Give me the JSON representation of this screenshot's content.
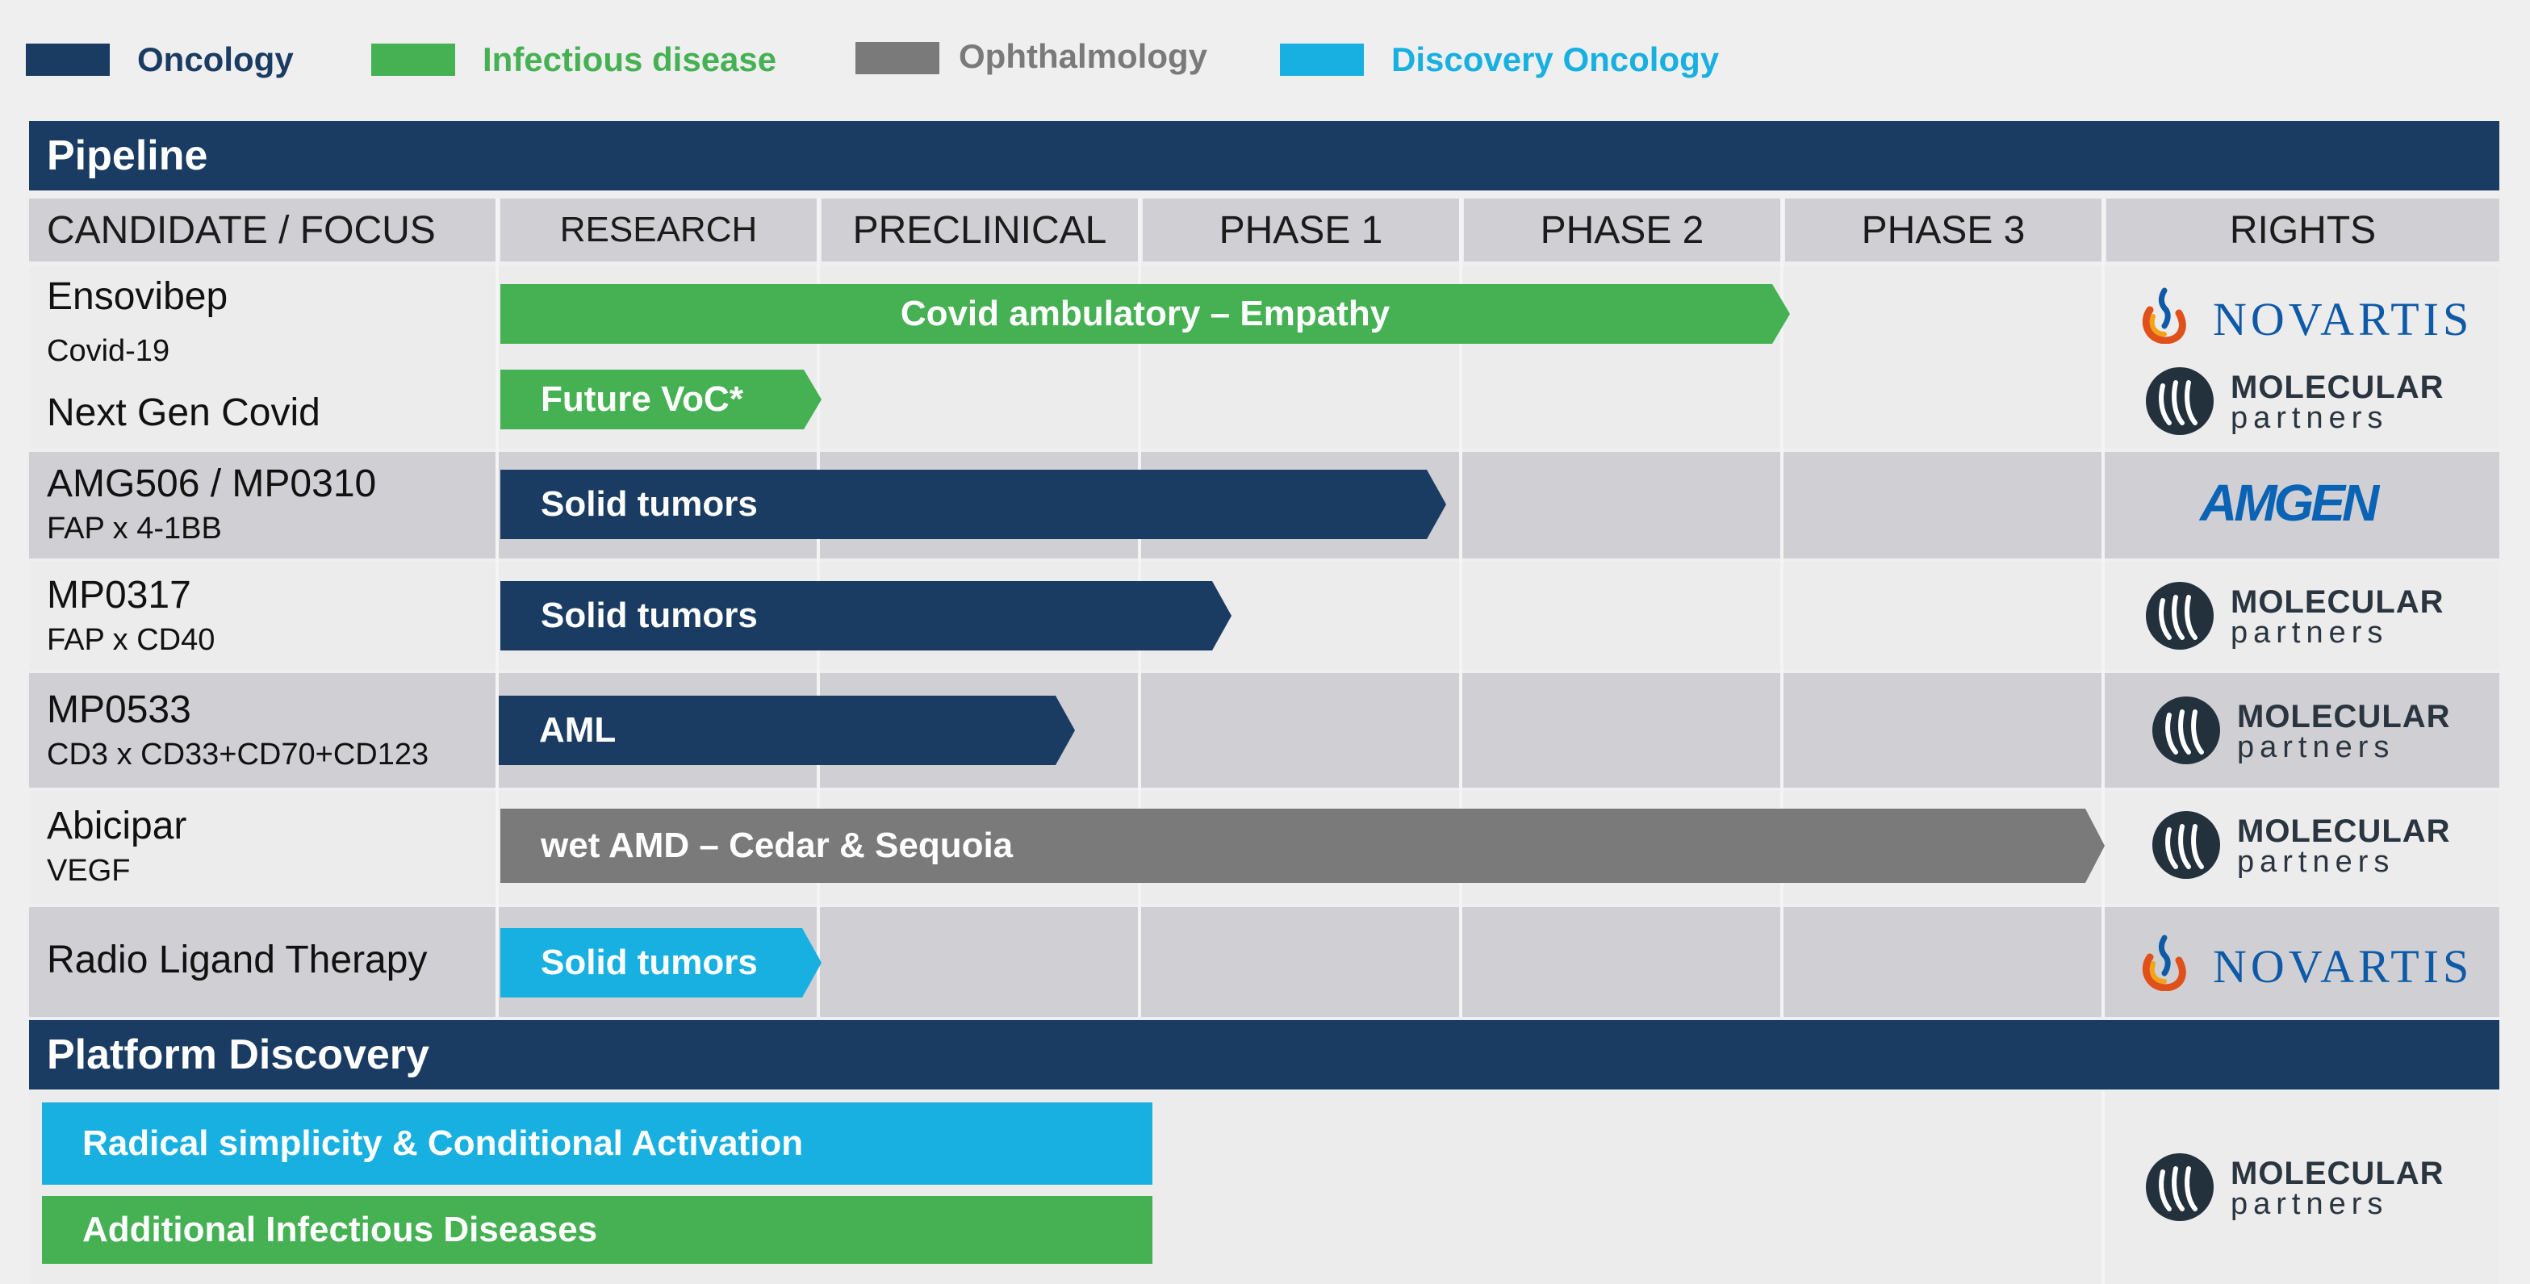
{
  "legend": [
    {
      "label": "Oncology",
      "color": "#1a3c63"
    },
    {
      "label": "Infectious disease",
      "color": "#45b153"
    },
    {
      "label": "Ophthalmology",
      "color": "#7a7a7a"
    },
    {
      "label": "Discovery Oncology",
      "color": "#17b0e0"
    }
  ],
  "pipeline": {
    "title": "Pipeline",
    "headers": [
      "CANDIDATE / FOCUS",
      "RESEARCH",
      "PRECLINICAL",
      "PHASE 1",
      "PHASE 2",
      "PHASE 3",
      "RIGHTS"
    ],
    "rows": [
      {
        "name": "Ensovibep",
        "sub": "Covid-19",
        "program": "Covid ambulatory – Empathy",
        "category": "Infectious disease",
        "rights": "NOVARTIS"
      },
      {
        "name": "Next Gen Covid",
        "sub": "",
        "program": "Future VoC*",
        "category": "Infectious disease",
        "rights": "MOLECULAR partners"
      },
      {
        "name": "AMG506 / MP0310",
        "sub": "FAP x 4-1BB",
        "program": "Solid tumors",
        "category": "Oncology",
        "rights": "AMGEN"
      },
      {
        "name": "MP0317",
        "sub": "FAP x CD40",
        "program": "Solid tumors",
        "category": "Oncology",
        "rights": "MOLECULAR partners"
      },
      {
        "name": "MP0533",
        "sub": "CD3 x CD33+CD70+CD123",
        "program": "AML",
        "category": "Oncology",
        "rights": "MOLECULAR partners"
      },
      {
        "name": "Abicipar",
        "sub": "VEGF",
        "program": "wet AMD – Cedar & Sequoia",
        "category": "Ophthalmology",
        "rights": "MOLECULAR partners"
      },
      {
        "name": "Radio Ligand Therapy",
        "sub": "",
        "program": "Solid tumors",
        "category": "Discovery Oncology",
        "rights": "NOVARTIS"
      }
    ]
  },
  "platform": {
    "title": "Platform Discovery",
    "bars": [
      {
        "label": "Radical simplicity & Conditional Activation",
        "category": "Discovery Oncology"
      },
      {
        "label": "Additional Infectious Diseases",
        "category": "Infectious disease"
      }
    ],
    "rights": "MOLECULAR partners"
  },
  "logos": {
    "novartis": "NOVARTIS",
    "mp_line1": "MOLECULAR",
    "mp_line2": "partners",
    "amgen": "AMGEN"
  },
  "colors": {
    "navy": "#1a3c63",
    "green": "#45b153",
    "gray": "#7a7a7a",
    "cyan": "#17b0e0",
    "novartis_blue": "#0e5aa7",
    "amgen_blue": "#0a63b4",
    "mp_text": "#2a3540"
  }
}
